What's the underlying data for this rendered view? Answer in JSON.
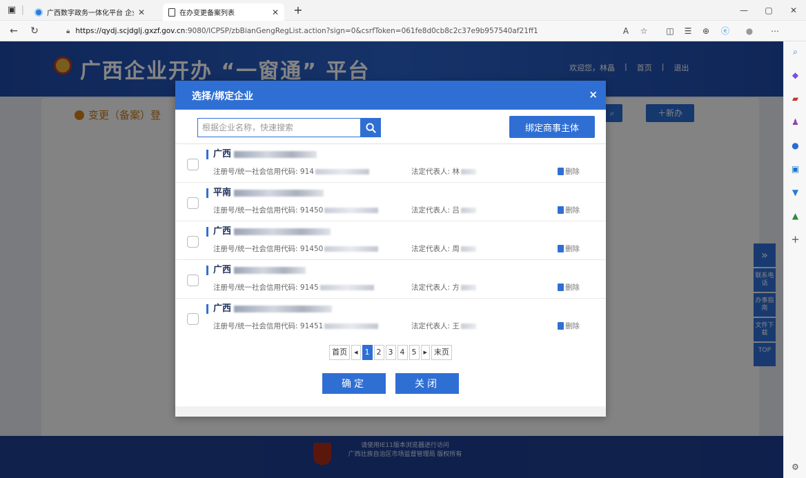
{
  "browser": {
    "tabs": [
      {
        "title": "广西数字政务一体化平台 企业开",
        "active": false
      },
      {
        "title": "在办变更备案列表",
        "active": true
      }
    ],
    "new_tab": "+",
    "url_host": "https://qydj.scjdglj.gxzf.gov.cn",
    "url_rest": ":9080/ICPSP/zbBianGengRegList.action?sign=0&csrfToken=061fe8d0cb8c2c37e9b957540af21ff1",
    "win_min": "—",
    "win_max": "▢",
    "win_close": "✕"
  },
  "page": {
    "site_title": "广西企业开办 “一窗通” 平台",
    "user_greeting": "欢迎您，林晶",
    "home_link": "首页",
    "logout_link": "退出",
    "sep": "|",
    "card_title": "变更（备案）登",
    "add_button": "＋新办",
    "footer_line1": "请使用IE11版本浏览器进行访问",
    "footer_line2": "广西壮族自治区市场监督管理局 版权所有",
    "float_bar": [
      "联系电话",
      "办事指南",
      "文件下载",
      "TOP"
    ]
  },
  "modal": {
    "title": "选择/绑定企业",
    "close": "×",
    "search_placeholder": "根据企业名称，快速搜索",
    "bind_button": "绑定商事主体",
    "code_label": "注册号/统一社会信用代码:",
    "rep_label": "法定代表人:",
    "delete_label": "删除",
    "items": [
      {
        "name_prefix": "广西",
        "code_prefix": "914",
        "rep_prefix": "林"
      },
      {
        "name_prefix": "平南",
        "code_prefix": "91450",
        "rep_prefix": "吕"
      },
      {
        "name_prefix": "广西",
        "code_prefix": "91450",
        "rep_prefix": "周"
      },
      {
        "name_prefix": "广西",
        "code_prefix": "9145",
        "rep_prefix": "方"
      },
      {
        "name_prefix": "广西",
        "code_prefix": "91451",
        "rep_prefix": "王"
      }
    ],
    "pager": {
      "first": "首页",
      "prev": "◀",
      "pages": [
        "1",
        "2",
        "3",
        "4",
        "5"
      ],
      "current": "1",
      "next": "▶",
      "last": "末页"
    },
    "confirm": "确定",
    "close_button": "关闭"
  }
}
